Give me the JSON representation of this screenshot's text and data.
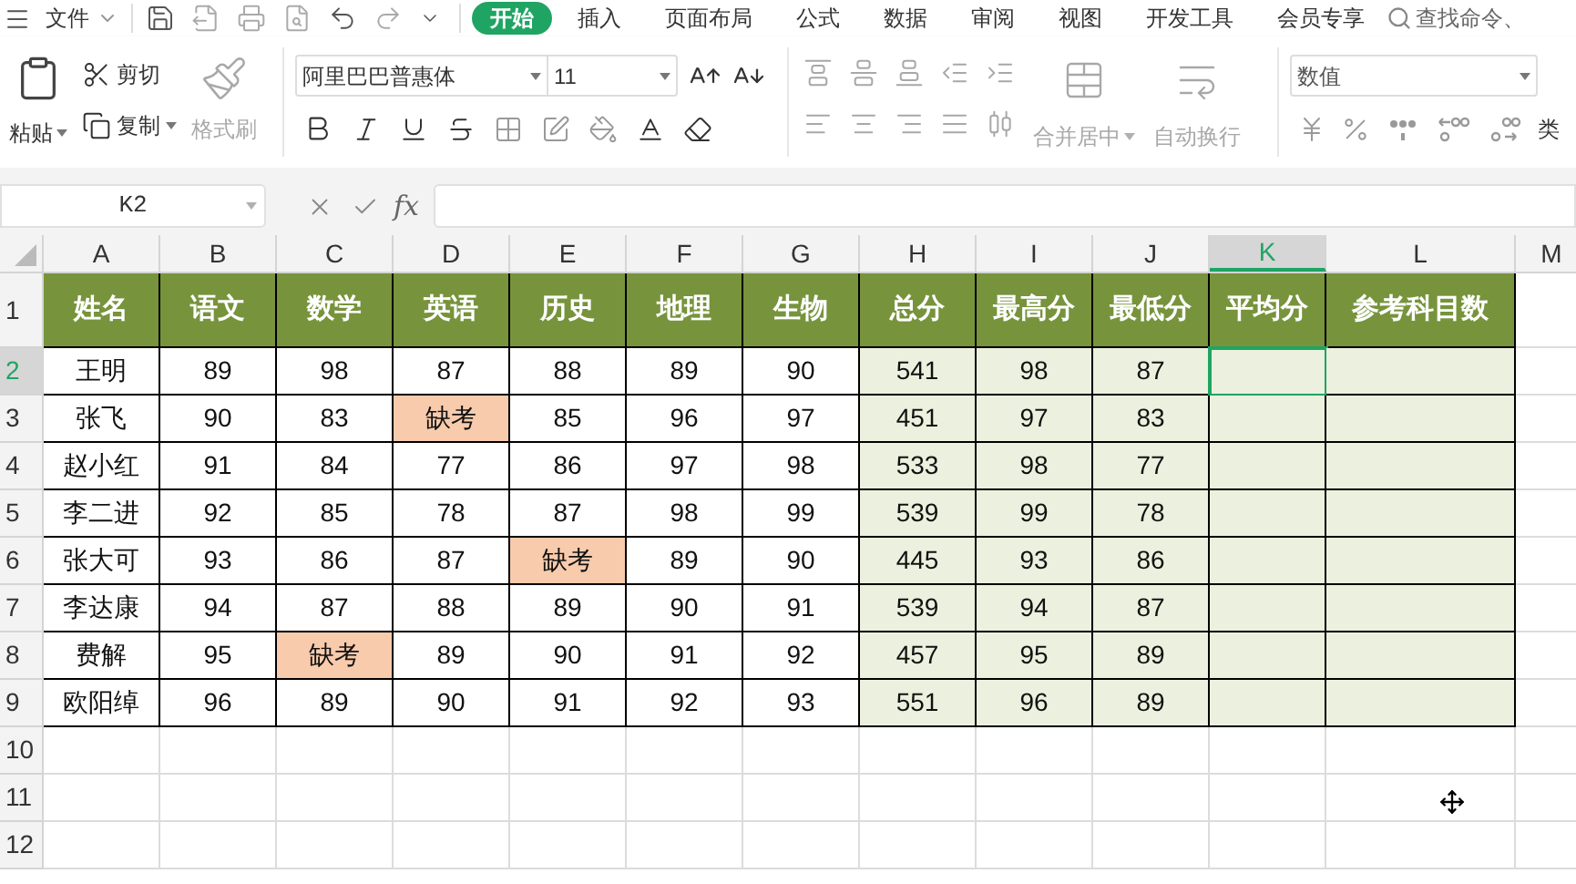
{
  "menu_bar": {
    "file_label": "文件",
    "tabs": [
      {
        "label": "开始",
        "selected": true
      },
      {
        "label": "插入",
        "selected": false
      },
      {
        "label": "页面布局",
        "selected": false
      },
      {
        "label": "公式",
        "selected": false
      },
      {
        "label": "数据",
        "selected": false
      },
      {
        "label": "审阅",
        "selected": false
      },
      {
        "label": "视图",
        "selected": false
      },
      {
        "label": "开发工具",
        "selected": false
      },
      {
        "label": "会员专享",
        "selected": false
      }
    ],
    "search": {
      "placeholder": "查找命令、"
    }
  },
  "ribbon": {
    "paste": {
      "label": "粘贴"
    },
    "cut": {
      "label": "剪切"
    },
    "copy": {
      "label": "复制"
    },
    "format_painter": {
      "label": "格式刷",
      "disabled": true
    },
    "font_name": "阿里巴巴普惠体",
    "font_size": "11",
    "merge": {
      "label": "合并居中",
      "disabled": true
    },
    "wrap": {
      "label": "自动换行",
      "disabled": true
    },
    "number_format": "数值",
    "cut_off_label": "类"
  },
  "formula_bar": {
    "name_box": "K2",
    "fx_label": "fx"
  },
  "columns": [
    {
      "letter": "A",
      "selected": false
    },
    {
      "letter": "B",
      "selected": false
    },
    {
      "letter": "C",
      "selected": false
    },
    {
      "letter": "D",
      "selected": false
    },
    {
      "letter": "E",
      "selected": false
    },
    {
      "letter": "F",
      "selected": false
    },
    {
      "letter": "G",
      "selected": false
    },
    {
      "letter": "H",
      "selected": false
    },
    {
      "letter": "I",
      "selected": false
    },
    {
      "letter": "J",
      "selected": false
    },
    {
      "letter": "K",
      "selected": true
    },
    {
      "letter": "L",
      "selected": false
    },
    {
      "letter": "M",
      "selected": false
    }
  ],
  "rows": [
    {
      "number": "1",
      "selected": false,
      "kind": "header",
      "cells": [
        "姓名",
        "语文",
        "数学",
        "英语",
        "历史",
        "地理",
        "生物",
        "总分",
        "最高分",
        "最低分",
        "平均分",
        "参考科目数"
      ]
    },
    {
      "number": "2",
      "selected": true,
      "kind": "data",
      "cells": [
        "王明",
        "89",
        "98",
        "87",
        "88",
        "89",
        "90",
        "541",
        "98",
        "87"
      ],
      "highlighted": [
        false,
        false,
        false,
        false,
        false,
        false,
        false,
        false,
        false,
        false
      ]
    },
    {
      "number": "3",
      "selected": false,
      "kind": "data",
      "cells": [
        "张飞",
        "90",
        "83",
        "缺考",
        "85",
        "96",
        "97",
        "451",
        "97",
        "83"
      ],
      "highlighted": [
        false,
        false,
        false,
        true,
        false,
        false,
        false,
        false,
        false,
        false
      ]
    },
    {
      "number": "4",
      "selected": false,
      "kind": "data",
      "cells": [
        "赵小红",
        "91",
        "84",
        "77",
        "86",
        "97",
        "98",
        "533",
        "98",
        "77"
      ],
      "highlighted": [
        false,
        false,
        false,
        false,
        false,
        false,
        false,
        false,
        false,
        false
      ]
    },
    {
      "number": "5",
      "selected": false,
      "kind": "data",
      "cells": [
        "李二进",
        "92",
        "85",
        "78",
        "87",
        "98",
        "99",
        "539",
        "99",
        "78"
      ],
      "highlighted": [
        false,
        false,
        false,
        false,
        false,
        false,
        false,
        false,
        false,
        false
      ]
    },
    {
      "number": "6",
      "selected": false,
      "kind": "data",
      "cells": [
        "张大可",
        "93",
        "86",
        "87",
        "缺考",
        "89",
        "90",
        "445",
        "93",
        "86"
      ],
      "highlighted": [
        false,
        false,
        false,
        false,
        true,
        false,
        false,
        false,
        false,
        false
      ]
    },
    {
      "number": "7",
      "selected": false,
      "kind": "data",
      "cells": [
        "李达康",
        "94",
        "87",
        "88",
        "89",
        "90",
        "91",
        "539",
        "94",
        "87"
      ],
      "highlighted": [
        false,
        false,
        false,
        false,
        false,
        false,
        false,
        false,
        false,
        false
      ]
    },
    {
      "number": "8",
      "selected": false,
      "kind": "data",
      "cells": [
        "费解",
        "95",
        "缺考",
        "89",
        "90",
        "91",
        "92",
        "457",
        "95",
        "89"
      ],
      "highlighted": [
        false,
        false,
        true,
        false,
        false,
        false,
        false,
        false,
        false,
        false
      ]
    },
    {
      "number": "9",
      "selected": false,
      "kind": "data",
      "cells": [
        "欧阳绰",
        "96",
        "89",
        "90",
        "91",
        "92",
        "93",
        "551",
        "96",
        "89"
      ],
      "highlighted": [
        false,
        false,
        false,
        false,
        false,
        false,
        false,
        false,
        false,
        false
      ]
    },
    {
      "number": "10",
      "selected": false,
      "kind": "empty"
    },
    {
      "number": "11",
      "selected": false,
      "kind": "empty"
    },
    {
      "number": "12",
      "selected": false,
      "kind": "empty"
    }
  ]
}
